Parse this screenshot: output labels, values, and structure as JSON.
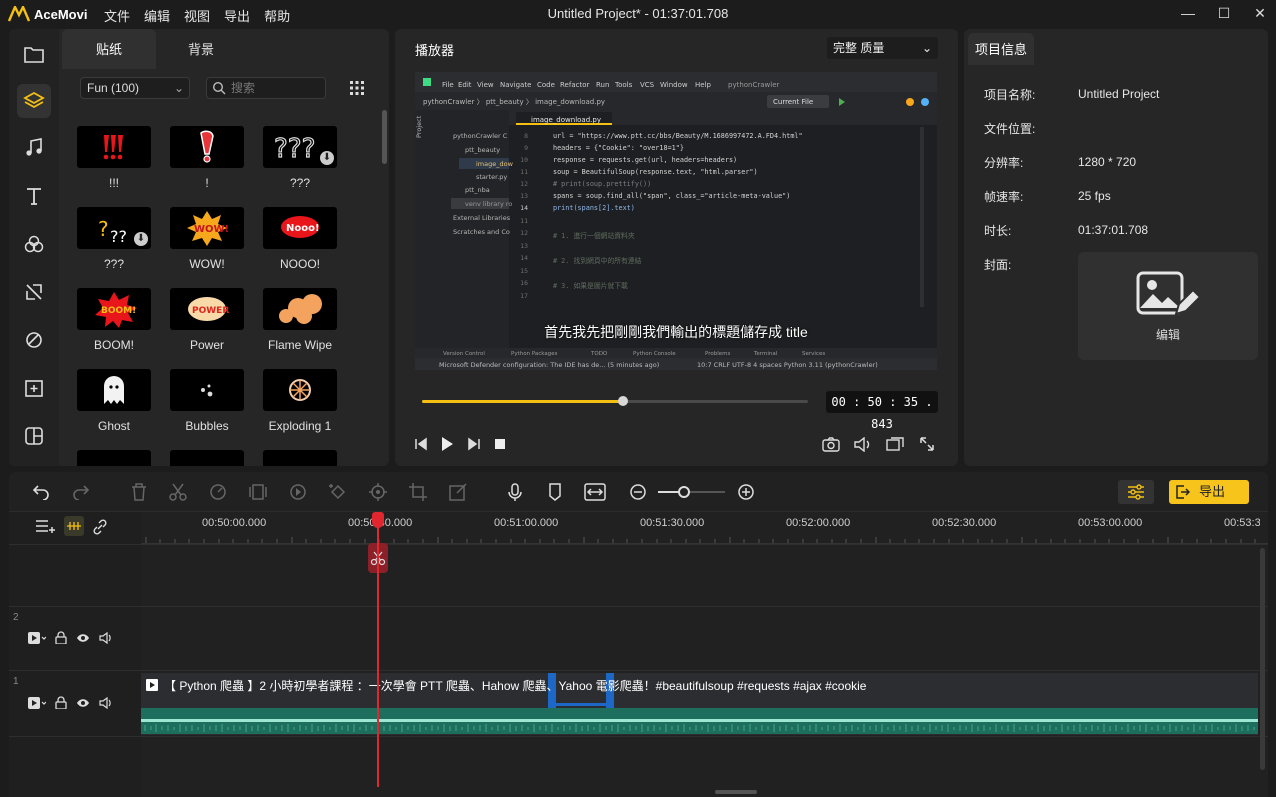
{
  "app": {
    "name": "AceMovi",
    "window_title": "Untitled Project* - 01:37:01.708"
  },
  "menu": [
    "文件",
    "编辑",
    "视图",
    "导出",
    "帮助"
  ],
  "left_panel": {
    "tabs": [
      "贴纸",
      "背景"
    ],
    "category": "Fun (100)",
    "search_placeholder": "搜索",
    "stickers": [
      {
        "label": "!!!"
      },
      {
        "label": "!"
      },
      {
        "label": "???"
      },
      {
        "label": "???"
      },
      {
        "label": "WOW!"
      },
      {
        "label": "NOOO!"
      },
      {
        "label": "BOOM!"
      },
      {
        "label": "Power"
      },
      {
        "label": "Flame Wipe"
      },
      {
        "label": "Ghost"
      },
      {
        "label": "Bubbles"
      },
      {
        "label": "Exploding 1"
      }
    ],
    "sticker_art": {
      "wow": "WOW!",
      "nooo": "Nooo!",
      "boom": "BOOM!",
      "power": "POWER"
    }
  },
  "player": {
    "title": "播放器",
    "quality": "完整 质量",
    "subtitle": "首先我先把剛剛我們輸出的標題儲存成 title",
    "timecode": "00 : 50 : 35 . 843",
    "progress": 0.52
  },
  "ide": {
    "menu": [
      "File",
      "Edit",
      "View",
      "Navigate",
      "Code",
      "Refactor",
      "Run",
      "Tools",
      "VCS",
      "Window",
      "Help",
      "pythonCrawler"
    ],
    "breadcrumb": "pythonCrawler 〉 ptt_beauty 〉 image_download.py",
    "tab": "image_download.py",
    "run_config": "Current File",
    "tree": [
      "Project",
      "pythonCrawler C",
      "ptt_beauty",
      "image_dow",
      "starter.py",
      "ptt_nba",
      "venv library ro",
      "External Libraries",
      "Scratches and Co"
    ],
    "line_numbers": [
      "8",
      "9",
      "10",
      "11",
      "12",
      "13",
      "14",
      "15",
      "16",
      "11",
      "12",
      "13",
      "14",
      "15",
      "16",
      "17"
    ],
    "code": [
      "url = \"https://www.ptt.cc/bbs/Beauty/M.1686997472.A.FD4.html\"",
      "headers = {\"Cookie\": \"over18=1\"}",
      "response = requests.get(url, headers=headers)",
      "soup = BeautifulSoup(response.text, \"html.parser\")",
      "# print(soup.prettify())",
      "spans = soup.find_all(\"span\", class_=\"article-meta-value\")",
      "print(spans[2].text)",
      "",
      "# 1. 進行一個網站資料夾",
      "",
      "# 2. 找到網頁中的所有連結",
      "",
      "# 3. 如果是圖片就下載",
      ""
    ],
    "bottom_tabs": [
      "Version Control",
      "Python Packages",
      "TODO",
      "Python Console",
      "Problems",
      "Terminal",
      "Services"
    ],
    "status_left": "Microsoft Defender configuration: The IDE has de... (5 minutes ago)",
    "status_right": "10:7   CRLF   UTF-8   4 spaces   Python 3.11 (pythonCrawler)"
  },
  "info": {
    "tab": "项目信息",
    "rows": [
      {
        "label": "项目名称:",
        "value": "Untitled Project"
      },
      {
        "label": "文件位置:",
        "value": ""
      },
      {
        "label": "分辨率:",
        "value": "1280 * 720"
      },
      {
        "label": "帧速率:",
        "value": "25 fps"
      },
      {
        "label": "时长:",
        "value": "01:37:01.708"
      },
      {
        "label": "封面:",
        "value": ""
      }
    ],
    "cover_label": "编辑"
  },
  "timeline": {
    "export_label": "导出",
    "ruler": [
      "00:50:00.000",
      "00:50:30.000",
      "00:51:00.000",
      "00:51:30.000",
      "00:52:00.000",
      "00:52:30.000",
      "00:53:00.000",
      "00:53:3"
    ],
    "tracks": [
      {
        "num": "2"
      },
      {
        "num": "1"
      }
    ],
    "clip_title": "【 Python 爬蟲 】2 小時初學者課程 ：一次學會 PTT 爬蟲、Hahow 爬蟲、Yahoo 電影爬蟲！#beautifulsoup  #requests #ajax #cookie"
  },
  "colors": {
    "accent": "#f7c41c",
    "playhead": "#e0262f",
    "audio": "#1d6e5c"
  }
}
